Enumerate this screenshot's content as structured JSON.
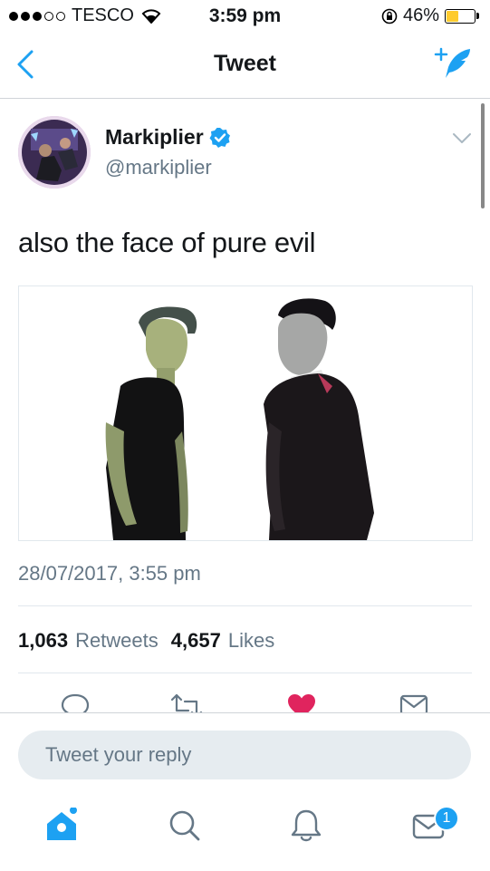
{
  "status_bar": {
    "carrier": "TESCO",
    "time": "3:59 pm",
    "battery": "46%",
    "battery_level": 0.46
  },
  "nav": {
    "title": "Tweet"
  },
  "tweet": {
    "author_name": "Markiplier",
    "handle": "@markiplier",
    "text": "also the face of pure evil",
    "timestamp": "28/07/2017, 3:55 pm",
    "retweets_count": "1,063",
    "retweets_label": "Retweets",
    "likes_count": "4,657",
    "likes_label": "Likes"
  },
  "reply": {
    "placeholder": "Tweet your reply"
  },
  "tabs": {
    "messages_badge": "1"
  },
  "colors": {
    "accent": "#1da1f2",
    "like": "#e0245e",
    "battery": "#fecb2f",
    "secondary_text": "#657786"
  },
  "icons": [
    "back-icon",
    "compose-icon",
    "verified-icon",
    "caret-down-icon",
    "reply-icon",
    "retweet-icon",
    "like-icon",
    "share-icon",
    "home-icon",
    "search-icon",
    "notifications-icon",
    "messages-icon"
  ]
}
